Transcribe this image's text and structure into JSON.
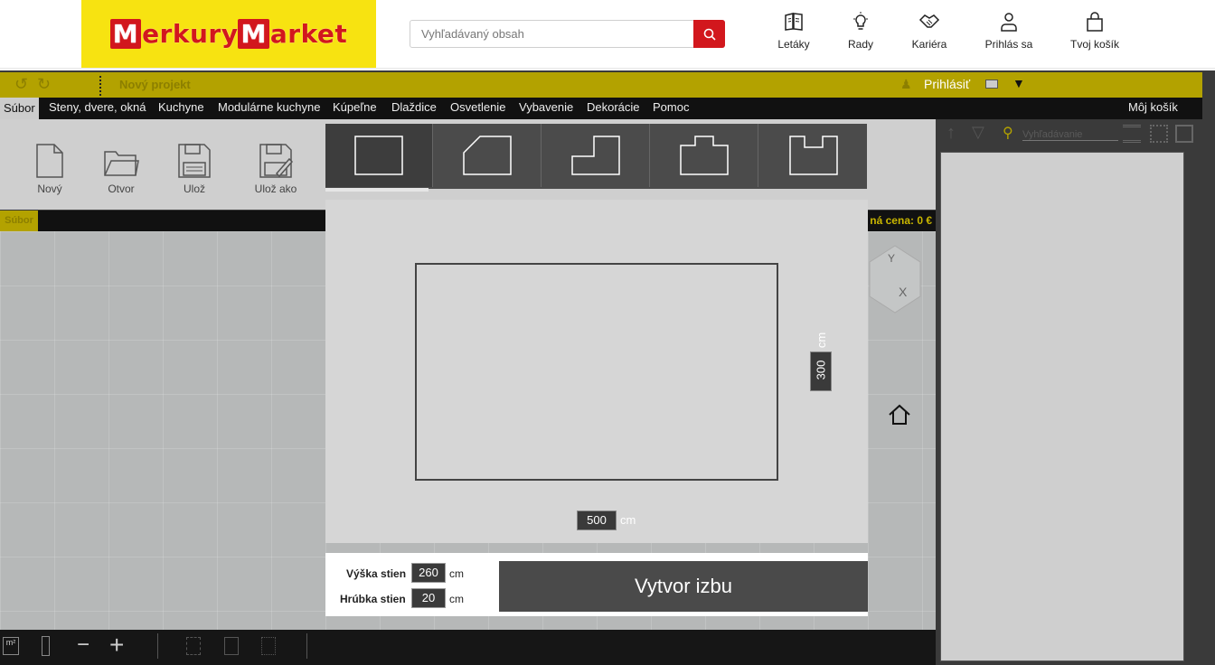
{
  "header": {
    "logo_text": "MerkuryMarket",
    "search_placeholder": "Vyhľadávaný obsah",
    "links": [
      {
        "label": "Letáky",
        "icon": "book-icon"
      },
      {
        "label": "Rady",
        "icon": "lightbulb-icon"
      },
      {
        "label": "Kariéra",
        "icon": "handshake-icon"
      },
      {
        "label": "Prihlás sa",
        "icon": "user-icon"
      },
      {
        "label": "Tvoj košík",
        "icon": "bag-icon"
      }
    ]
  },
  "topbar": {
    "project_name": "Nový projekt",
    "login_label": "Prihlásiť"
  },
  "menu": {
    "items": [
      "Súbor",
      "Steny, dvere, okná",
      "Kuchyne",
      "Modulárne kuchyne",
      "Kúpeľne",
      "Dlaždice",
      "Osvetlenie",
      "Vybavenie",
      "Dekorácie",
      "Pomoc"
    ],
    "cart_label": "Môj košík"
  },
  "ribbon": {
    "buttons": [
      "Nový",
      "Otvor",
      "Ulož",
      "Ulož ako"
    ],
    "section_tag": "Súbor",
    "price_label": "ná cena: 0 €"
  },
  "right_panel": {
    "search_placeholder": "Vyhľadávanie"
  },
  "room_dialog": {
    "shape_tabs": [
      "rectangle",
      "cut-corner",
      "l-shape",
      "t-shape",
      "u-shape"
    ],
    "selected_shape": "rectangle",
    "width_value": "500",
    "depth_value": "300",
    "unit": "cm",
    "wall_height_label": "Výška stien",
    "wall_height_value": "260",
    "wall_thickness_label": "Hrúbka stien",
    "wall_thickness_value": "20",
    "create_button": "Vytvor izbu"
  }
}
